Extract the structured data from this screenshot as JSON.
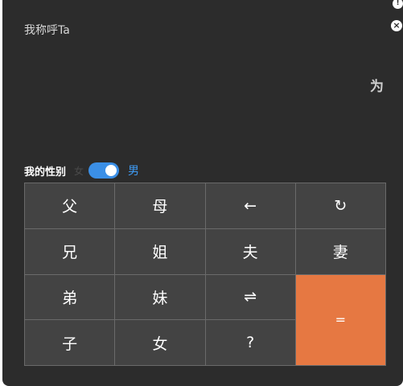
{
  "title": "我称呼Ta",
  "result": "为",
  "gender": {
    "label": "我的性别",
    "off_option": "女",
    "value": "男"
  },
  "keys": {
    "father": "父",
    "mother": "母",
    "back": "←",
    "reset": "↻",
    "elder_brother": "兄",
    "elder_sister": "姐",
    "husband": "夫",
    "wife": "妻",
    "younger_brother": "弟",
    "younger_sister": "妹",
    "swap": "⇌",
    "equal": "=",
    "son": "子",
    "daughter": "女",
    "question": "?"
  },
  "icons": {
    "close": "×",
    "info": "!"
  },
  "colors": {
    "panel_bg": "#2c2c2c",
    "key_bg": "#434343",
    "accent_toggle": "#3b8fe6",
    "equal_key": "#e67842"
  }
}
